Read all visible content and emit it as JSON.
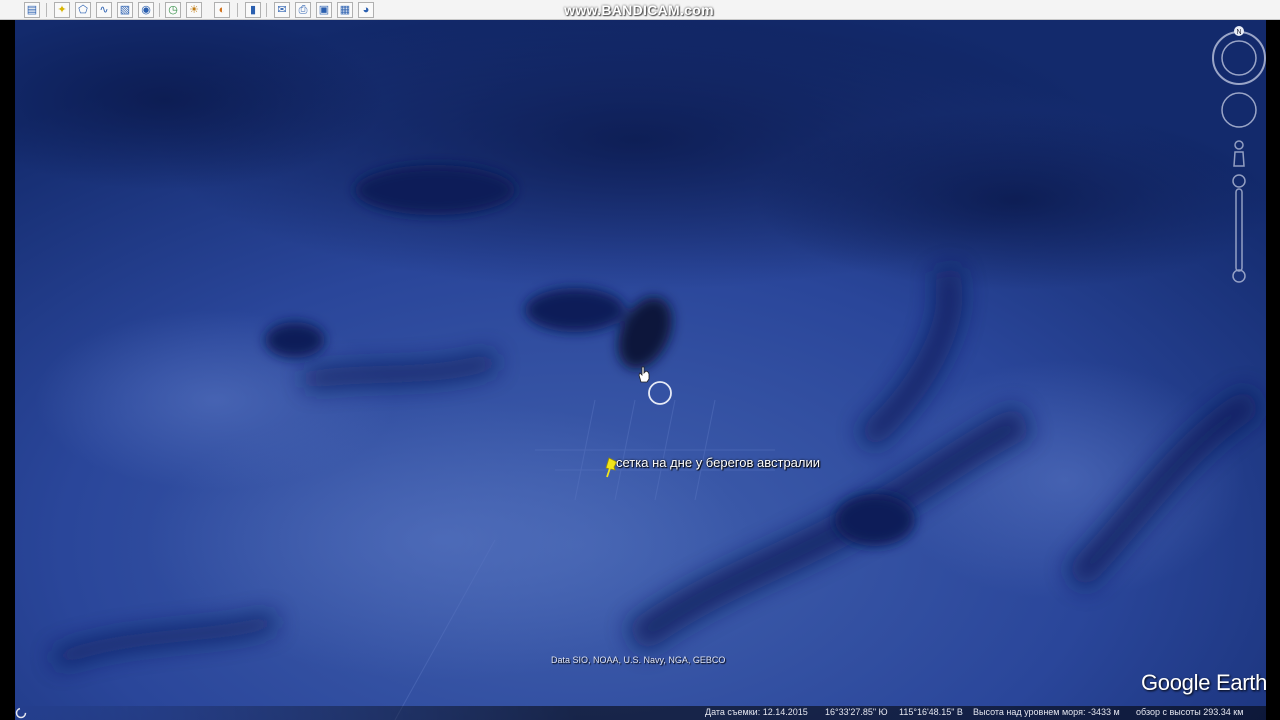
{
  "window": {
    "watermark": "www.BANDICAM.com"
  },
  "toolbar": {
    "buttons": [
      {
        "name": "sidebar-toggle-button",
        "icon": "sidebar-icon"
      },
      {
        "name": "add-placemark-button",
        "icon": "pushpin-icon"
      },
      {
        "name": "add-polygon-button",
        "icon": "polygon-icon"
      },
      {
        "name": "add-path-button",
        "icon": "path-icon"
      },
      {
        "name": "add-image-overlay-button",
        "icon": "overlay-icon"
      },
      {
        "name": "record-tour-button",
        "icon": "tour-icon"
      },
      {
        "name": "historical-imagery-button",
        "icon": "clock-icon"
      },
      {
        "name": "sunlight-button",
        "icon": "sun-icon"
      },
      {
        "name": "switch-planet-button",
        "icon": "planet-icon"
      },
      {
        "name": "ruler-button",
        "icon": "ruler-icon"
      },
      {
        "name": "email-button",
        "icon": "email-icon"
      },
      {
        "name": "print-button",
        "icon": "print-icon"
      },
      {
        "name": "save-image-button",
        "icon": "save-image-icon"
      },
      {
        "name": "view-in-maps-button",
        "icon": "maps-icon"
      }
    ]
  },
  "map": {
    "placemark_label": "сетка на дне у берегов австралии",
    "data_credit": "Data SIO, NOAA, U.S. Navy, NGA, GEBCO",
    "logo": "Google Earth",
    "compass_letter": "N"
  },
  "status_bar": {
    "date": "Дата съемки: 12.14.2015",
    "lat": "16°33'27.85\" Ю",
    "lon": "115°16'48.15\" В",
    "altitude": "Высота над уровнем моря: -3433 м",
    "view_altitude": "обзор с высоты 293.34 км"
  },
  "colors": {
    "ocean_deep": "#14286a",
    "ocean_light": "#3a58a8",
    "pin": "#f2e51a"
  }
}
